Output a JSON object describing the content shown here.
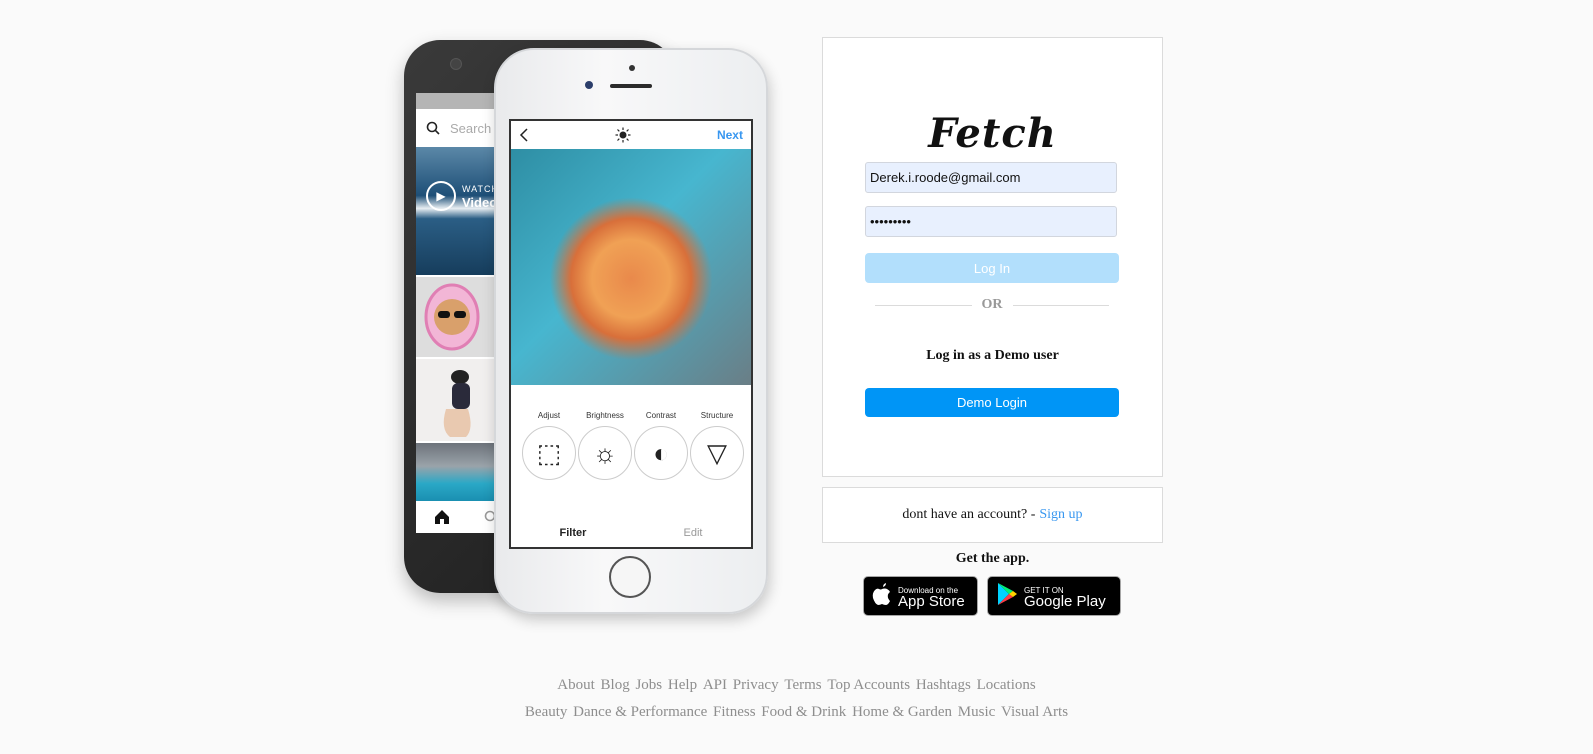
{
  "brand": {
    "logo_text": "Fetch"
  },
  "phone_back": {
    "search_placeholder": "Search",
    "watch_small": "WATCH",
    "watch_big": "Video"
  },
  "phone_front": {
    "next_label": "Next",
    "tools": [
      {
        "label": "Adjust"
      },
      {
        "label": "Brightness"
      },
      {
        "label": "Contrast"
      },
      {
        "label": "Structure"
      }
    ],
    "tab_filter": "Filter",
    "tab_edit": "Edit"
  },
  "login": {
    "email_value": "Derek.i.roode@gmail.com",
    "password_value": "•••••••••",
    "login_button": "Log In",
    "or_text": "OR",
    "demo_label": "Log in as a Demo user",
    "demo_button": "Demo Login"
  },
  "signup": {
    "prompt": "dont have an account? -",
    "link": "Sign up"
  },
  "app": {
    "title": "Get the app.",
    "apple_small": "Download on the",
    "apple_big": "App Store",
    "google_small": "GET IT ON",
    "google_big": "Google Play"
  },
  "footer": {
    "row1": [
      "About",
      "Blog",
      "Jobs",
      "Help",
      "API",
      "Privacy",
      "Terms",
      "Top Accounts",
      "Hashtags",
      "Locations"
    ],
    "row2": [
      "Beauty",
      "Dance & Performance",
      "Fitness",
      "Food & Drink",
      "Home & Garden",
      "Music",
      "Visual Arts"
    ]
  },
  "colors": {
    "primary": "#0095f6",
    "primary_disabled": "#b2dffc",
    "link": "#3897f0",
    "border": "#dbdbdb"
  }
}
